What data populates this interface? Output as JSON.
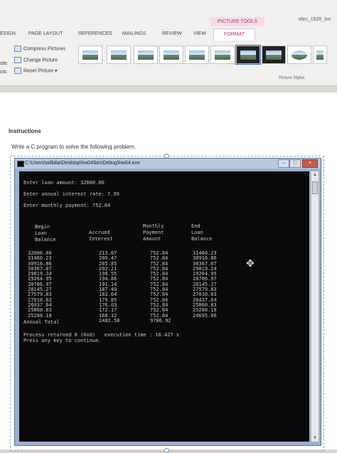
{
  "ribbon": {
    "context_label": "PICTURE TOOLS",
    "doc_title": "elec_1520_loo",
    "tabs": [
      "ESIGN",
      "PAGE LAYOUT",
      "REFERENCES",
      "MAILINGS",
      "REVIEW",
      "VIEW",
      "FORMAT"
    ],
    "commands": [
      "Compress Pictures",
      "Change Picture",
      "Reset Picture"
    ],
    "left_cut": [
      "stic",
      "cts"
    ],
    "group_label": "Picture Styles"
  },
  "document": {
    "heading": "Instructions",
    "task": "Write a C program to solve the following problem."
  },
  "console": {
    "title": "C:\\Users\\willidia\\Desktop\\hw04\\bin\\Debug\\hw04.exe",
    "prompts": [
      "Enter loan amount: 32000.00",
      "Enter annual interest rate: 7.99",
      "Enter monthly payment: 752.84"
    ],
    "headers": {
      "begin": "Begin\nLoan\nBalance",
      "accrued": "Accrued\nInterest",
      "monthly": "Monthly\nPayment\nAmount",
      "end": "End\nLoan\nBalance"
    },
    "begin_balance": [
      "32000.00",
      "31460.23",
      "30916.86",
      "30367.87",
      "29819.24",
      "29264.95",
      "28706.97",
      "28145.27",
      "27579.83",
      "27010.63",
      "26437.64",
      "25860.83",
      "25280.18"
    ],
    "accrued_interest": [
      "213.07",
      "209.47",
      "205.85",
      "202.21",
      "198.55",
      "194.86",
      "191.14",
      "187.40",
      "183.64",
      "179.85",
      "176.03",
      "172.17",
      "168.32"
    ],
    "monthly_payment": [
      "752.84",
      "752.84",
      "752.84",
      "752.84",
      "752.84",
      "752.84",
      "752.84",
      "752.84",
      "752.84",
      "752.84",
      "752.84",
      "752.84",
      "752.84"
    ],
    "end_balance": [
      "31460.23",
      "30916.86",
      "30367.87",
      "29819.24",
      "29264.95",
      "28706.97",
      "28145.27",
      "27579.83",
      "27010.63",
      "26437.64",
      "25860.83",
      "25280.18",
      "24695.66"
    ],
    "annual_total_label": "Annual Total",
    "annual_total_interest": "2482.58",
    "annual_total_payment": "9786.92",
    "process_line": "Process returned 0 (0x0)   execution time : 16.427 s",
    "continue_line": "Press any key to continue."
  }
}
